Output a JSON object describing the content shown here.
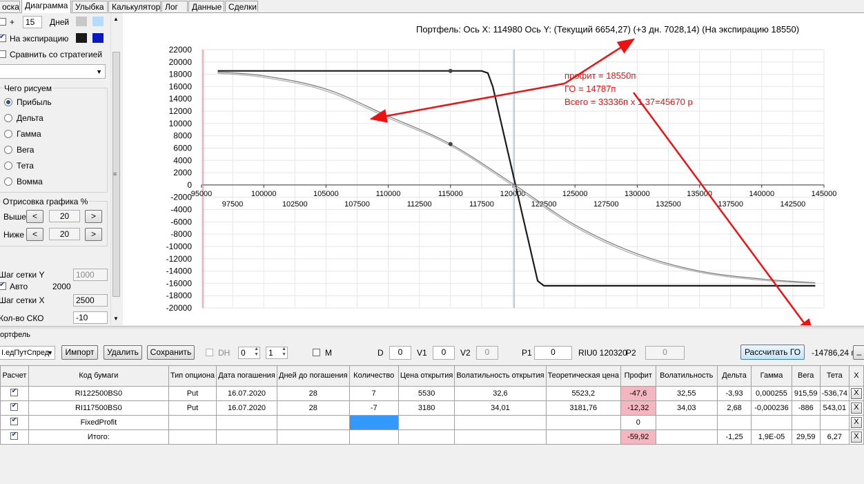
{
  "tabs": [
    "оска",
    "Диаграмма",
    "Улыбка",
    "Калькулятор",
    "Лог",
    "Данные",
    "Сделки"
  ],
  "left": {
    "plus_label": "+",
    "days_value": "15",
    "days_label": "Дней",
    "expiry_label": "На экспирацию",
    "compare_label": "Сравнить со стратегией",
    "what_group": "Чего рисуем",
    "radios": [
      "Прибыль",
      "Дельта",
      "Гамма",
      "Вега",
      "Тета",
      "Вомма"
    ],
    "draw_group": "Отрисовка графика %",
    "above_label": "Выше",
    "above_value": "20",
    "below_label": "Ниже",
    "below_value": "20",
    "lt": "<",
    "gt": ">",
    "gridy_label": "Шаг сетки Y",
    "gridy_value": "1000",
    "auto_label": "Авто",
    "auto_value": "2000",
    "gridx_label": "Шаг сетки X",
    "gridx_value": "2500",
    "sko_label": "Кол-во СКО",
    "sko_value": "-10",
    "swatch_colors": [
      "#c8c8c8",
      "#b4dcff",
      "#1a1a1a",
      "#0a1abf"
    ]
  },
  "chart_data": {
    "type": "line",
    "title": "Портфель: Ось X:  114980 Ось Y:   (Текущий 6654,27)  (+3 дн. 7028,14)  (На экспирацию 18550)",
    "xlim": [
      95000,
      145000
    ],
    "ylim": [
      -20000,
      22000
    ],
    "x_ticks_top": [
      "95000",
      "100000",
      "105000",
      "110000",
      "115000",
      "120000",
      "125000",
      "130000",
      "135000",
      "140000",
      "145000"
    ],
    "x_ticks_bottom": [
      "97500",
      "102500",
      "107500",
      "112500",
      "117500",
      "122500",
      "127500",
      "132500",
      "137500",
      "142500"
    ],
    "y_ticks": [
      "22000",
      "20000",
      "18000",
      "16000",
      "14000",
      "12000",
      "10000",
      "8000",
      "6000",
      "4000",
      "2000",
      "0",
      "-2000",
      "-4000",
      "-6000",
      "-8000",
      "-10000",
      "-12000",
      "-14000",
      "-16000",
      "-18000",
      "-20000"
    ],
    "series": [
      {
        "color": "#1a1a1a",
        "points": [
          [
            96300,
            18550
          ],
          [
            117500,
            18550
          ],
          [
            118000,
            18200
          ],
          [
            118400,
            16000
          ],
          [
            122000,
            -15600
          ],
          [
            122500,
            -16400
          ],
          [
            144300,
            -16400
          ]
        ]
      },
      {
        "color": "#808080",
        "points": [
          [
            96300,
            18350
          ],
          [
            100000,
            17750
          ],
          [
            105000,
            15600
          ],
          [
            110000,
            11200
          ],
          [
            115000,
            6654
          ],
          [
            120000,
            200
          ],
          [
            125000,
            -6500
          ],
          [
            130000,
            -11200
          ],
          [
            135000,
            -14000
          ],
          [
            140000,
            -15300
          ],
          [
            144300,
            -15900
          ]
        ]
      },
      {
        "color": "#b0b0b0",
        "points": [
          [
            96300,
            18150
          ],
          [
            100000,
            17500
          ],
          [
            105000,
            15300
          ],
          [
            110000,
            10900
          ],
          [
            115000,
            6400
          ],
          [
            120000,
            -100
          ],
          [
            125000,
            -6800
          ],
          [
            130000,
            -11500
          ],
          [
            135000,
            -14200
          ],
          [
            140000,
            -15500
          ],
          [
            144300,
            -16000
          ]
        ]
      }
    ],
    "markers": [
      [
        115000,
        18550
      ],
      [
        115000,
        6654
      ]
    ],
    "cursor_x": 120000,
    "red_line_x": 95000,
    "annotations": [
      "профит = 18550п",
      "ГО = 14787п",
      "Всего = 33336п х 1,37=45670 р"
    ]
  },
  "portfolio": {
    "group_label": "ортфель",
    "strategy": "I.едПутСпред",
    "import": "Импорт",
    "delete": "Удалить",
    "save": "Сохранить",
    "dh_label": "DH",
    "dh1": "0",
    "dh2": "1",
    "m_label": "M",
    "d_label": "D",
    "d_value": "0",
    "v1_label": "V1",
    "v1_value": "0",
    "v2_label": "V2",
    "v2_value": "0",
    "p1_label": "P1",
    "p1_value": "0",
    "riu_label": "RIU0 120320",
    "p2_label": "P2",
    "p2_value": "0",
    "calc_button": "Рассчитать ГО",
    "go_value": "-14786,24 п",
    "extra_button": "_"
  },
  "table": {
    "headers": [
      "Расчет",
      "Код бумаги",
      "Тип опциона",
      "Дата погашения",
      "Дней до погашения",
      "Количество",
      "Цена открытия",
      "Волатильность открытия",
      "Теоретическая цена",
      "Профит",
      "Волатильность",
      "Дельта",
      "Гамма",
      "Вега",
      "Тета",
      "X"
    ],
    "rows": [
      [
        "",
        "RI122500BS0",
        "Put",
        "16.07.2020",
        "28",
        "7",
        "5530",
        "32,6",
        "5523,2",
        "-47,6",
        "32,55",
        "-3,93",
        "0,000255",
        "915,59",
        "-536,74",
        "X"
      ],
      [
        "",
        "RI117500BS0",
        "Put",
        "16.07.2020",
        "28",
        "-7",
        "3180",
        "34,01",
        "3181,76",
        "-12,32",
        "34,03",
        "2,68",
        "-0,000236",
        "-886",
        "543,01",
        "X"
      ],
      [
        "",
        "FixedProfit",
        "",
        "",
        "",
        "",
        "",
        "",
        "",
        "0",
        "",
        "",
        "",
        "",
        "",
        "X"
      ],
      [
        "",
        "Итого:",
        "",
        "",
        "",
        "",
        "",
        "",
        "",
        "-59,92",
        "",
        "-1,25",
        "1,9E-05",
        "29,59",
        "6,27",
        "X"
      ]
    ]
  }
}
